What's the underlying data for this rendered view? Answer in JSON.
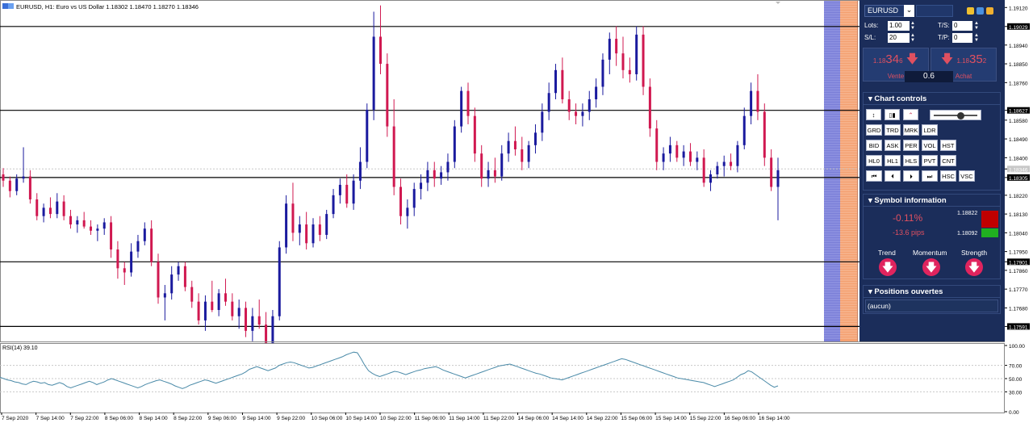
{
  "chart": {
    "header": "EURUSD, H1:  Euro vs US Dollar  1.18302 1.18470 1.18270 1.18346",
    "rsi_label": "RSI(14) 39.10",
    "price_axis": [
      "1.19120",
      "1.19029",
      "1.18940",
      "1.18850",
      "1.18760",
      "1.18627",
      "1.18580",
      "1.18490",
      "1.18400",
      "1.18346",
      "1.18305",
      "1.18220",
      "1.18130",
      "1.18040",
      "1.17950",
      "1.17901",
      "1.17860",
      "1.17770",
      "1.17680",
      "1.17591"
    ],
    "rsi_axis": [
      "100.00",
      "70.00",
      "50.00",
      "30.00",
      "0.00"
    ],
    "time_axis": [
      "7 Sep 2020",
      "7 Sep 14:00",
      "7 Sep 22:00",
      "8 Sep 06:00",
      "8 Sep 14:00",
      "8 Sep 22:00",
      "9 Sep 06:00",
      "9 Sep 14:00",
      "9 Sep 22:00",
      "10 Sep 06:00",
      "10 Sep 14:00",
      "10 Sep 22:00",
      "11 Sep 06:00",
      "11 Sep 14:00",
      "11 Sep 22:00",
      "14 Sep 06:00",
      "14 Sep 14:00",
      "14 Sep 22:00",
      "15 Sep 06:00",
      "15 Sep 14:00",
      "15 Sep 22:00",
      "16 Sep 06:00",
      "16 Sep 14:00"
    ],
    "level_lines": [
      1.19029,
      1.18627,
      1.18305,
      1.17901,
      1.17591
    ],
    "colors": {
      "bull": "#1a1a9e",
      "bear": "#d01850",
      "rsi": "#4a8aa8",
      "band_blue": "#7b7fd8",
      "band_orange": "#f4a070"
    },
    "candles": [
      [
        1.1832,
        1.1835,
        1.1826,
        1.1829
      ],
      [
        1.1829,
        1.1831,
        1.1821,
        1.1824
      ],
      [
        1.1824,
        1.1832,
        1.1822,
        1.183
      ],
      [
        1.183,
        1.1845,
        1.1828,
        1.1831
      ],
      [
        1.1831,
        1.1834,
        1.1818,
        1.182
      ],
      [
        1.182,
        1.1823,
        1.181,
        1.1812
      ],
      [
        1.1812,
        1.1818,
        1.1809,
        1.1816
      ],
      [
        1.1816,
        1.1821,
        1.1811,
        1.1813
      ],
      [
        1.1813,
        1.1823,
        1.1811,
        1.1819
      ],
      [
        1.1819,
        1.1822,
        1.181,
        1.1812
      ],
      [
        1.1812,
        1.1815,
        1.1806,
        1.1808
      ],
      [
        1.1808,
        1.1812,
        1.1804,
        1.181
      ],
      [
        1.181,
        1.1814,
        1.1806,
        1.1807
      ],
      [
        1.1807,
        1.181,
        1.1803,
        1.1805
      ],
      [
        1.1805,
        1.1808,
        1.18,
        1.1806
      ],
      [
        1.1806,
        1.1811,
        1.1803,
        1.1809
      ],
      [
        1.1809,
        1.1812,
        1.1792,
        1.1796
      ],
      [
        1.1796,
        1.18,
        1.1782,
        1.1787
      ],
      [
        1.1787,
        1.179,
        1.1779,
        1.1785
      ],
      [
        1.1785,
        1.1799,
        1.1783,
        1.1795
      ],
      [
        1.1795,
        1.1803,
        1.1792,
        1.18
      ],
      [
        1.18,
        1.1809,
        1.1798,
        1.1806
      ],
      [
        1.1806,
        1.181,
        1.1788,
        1.179
      ],
      [
        1.179,
        1.1794,
        1.177,
        1.1773
      ],
      [
        1.1773,
        1.1779,
        1.1762,
        1.1775
      ],
      [
        1.1775,
        1.1788,
        1.1772,
        1.1784
      ],
      [
        1.1784,
        1.179,
        1.1781,
        1.1788
      ],
      [
        1.1788,
        1.179,
        1.1776,
        1.1778
      ],
      [
        1.1778,
        1.1781,
        1.1768,
        1.1771
      ],
      [
        1.1771,
        1.1775,
        1.176,
        1.1762
      ],
      [
        1.1762,
        1.1774,
        1.1757,
        1.1771
      ],
      [
        1.1771,
        1.1781,
        1.1766,
        1.1767
      ],
      [
        1.1767,
        1.1777,
        1.1764,
        1.1775
      ],
      [
        1.1775,
        1.1782,
        1.1769,
        1.1771
      ],
      [
        1.1771,
        1.1775,
        1.1762,
        1.1764
      ],
      [
        1.1764,
        1.1772,
        1.1758,
        1.1768
      ],
      [
        1.1768,
        1.1771,
        1.1754,
        1.1757
      ],
      [
        1.1757,
        1.1768,
        1.1752,
        1.1764
      ],
      [
        1.1764,
        1.1772,
        1.1758,
        1.176
      ],
      [
        1.176,
        1.1766,
        1.1748,
        1.1751
      ],
      [
        1.1751,
        1.1767,
        1.1749,
        1.1764
      ],
      [
        1.1764,
        1.18,
        1.1762,
        1.1797
      ],
      [
        1.1797,
        1.1822,
        1.1794,
        1.1818
      ],
      [
        1.1818,
        1.1828,
        1.18,
        1.1804
      ],
      [
        1.1804,
        1.1812,
        1.1798,
        1.1808
      ],
      [
        1.1808,
        1.1814,
        1.1796,
        1.1799
      ],
      [
        1.1799,
        1.1811,
        1.1797,
        1.1808
      ],
      [
        1.1808,
        1.1812,
        1.18,
        1.1803
      ],
      [
        1.1803,
        1.1815,
        1.1801,
        1.1813
      ],
      [
        1.1813,
        1.1825,
        1.1811,
        1.1822
      ],
      [
        1.1822,
        1.183,
        1.1818,
        1.1827
      ],
      [
        1.1827,
        1.1832,
        1.1816,
        1.1818
      ],
      [
        1.1818,
        1.1832,
        1.1815,
        1.1829
      ],
      [
        1.1829,
        1.1845,
        1.1825,
        1.1838
      ],
      [
        1.1838,
        1.1866,
        1.1835,
        1.1863
      ],
      [
        1.1863,
        1.191,
        1.1858,
        1.1898
      ],
      [
        1.1898,
        1.1913,
        1.188,
        1.1885
      ],
      [
        1.1885,
        1.189,
        1.185,
        1.1855
      ],
      [
        1.1855,
        1.1868,
        1.1822,
        1.1826
      ],
      [
        1.1826,
        1.183,
        1.1808,
        1.1812
      ],
      [
        1.1812,
        1.182,
        1.1806,
        1.1816
      ],
      [
        1.1816,
        1.1828,
        1.1812,
        1.1825
      ],
      [
        1.1825,
        1.1832,
        1.182,
        1.1828
      ],
      [
        1.1828,
        1.1838,
        1.1824,
        1.1834
      ],
      [
        1.1834,
        1.1838,
        1.1826,
        1.183
      ],
      [
        1.183,
        1.1836,
        1.1827,
        1.1833
      ],
      [
        1.1833,
        1.1842,
        1.1829,
        1.1838
      ],
      [
        1.1838,
        1.1858,
        1.1835,
        1.1855
      ],
      [
        1.1855,
        1.1874,
        1.1852,
        1.1872
      ],
      [
        1.1872,
        1.1876,
        1.1856,
        1.186
      ],
      [
        1.186,
        1.1864,
        1.1838,
        1.1842
      ],
      [
        1.1842,
        1.1846,
        1.1826,
        1.183
      ],
      [
        1.183,
        1.1838,
        1.1826,
        1.1834
      ],
      [
        1.1834,
        1.184,
        1.1828,
        1.1831
      ],
      [
        1.1831,
        1.1846,
        1.1829,
        1.1842
      ],
      [
        1.1842,
        1.1852,
        1.1838,
        1.1848
      ],
      [
        1.1848,
        1.1855,
        1.1841,
        1.1844
      ],
      [
        1.1844,
        1.185,
        1.1834,
        1.1838
      ],
      [
        1.1838,
        1.1848,
        1.1835,
        1.1846
      ],
      [
        1.1846,
        1.1856,
        1.1842,
        1.1852
      ],
      [
        1.1852,
        1.1866,
        1.1848,
        1.1862
      ],
      [
        1.1862,
        1.1876,
        1.1858,
        1.1871
      ],
      [
        1.1871,
        1.1885,
        1.1868,
        1.1882
      ],
      [
        1.1882,
        1.1888,
        1.1866,
        1.1868
      ],
      [
        1.1868,
        1.1872,
        1.1858,
        1.1862
      ],
      [
        1.1862,
        1.1866,
        1.1856,
        1.186
      ],
      [
        1.186,
        1.1866,
        1.1855,
        1.1862
      ],
      [
        1.1862,
        1.1872,
        1.1858,
        1.1868
      ],
      [
        1.1868,
        1.1878,
        1.1864,
        1.1874
      ],
      [
        1.1874,
        1.189,
        1.187,
        1.1887
      ],
      [
        1.1887,
        1.19,
        1.188,
        1.1897
      ],
      [
        1.1897,
        1.1903,
        1.1884,
        1.189
      ],
      [
        1.189,
        1.1898,
        1.1878,
        1.1882
      ],
      [
        1.1882,
        1.1888,
        1.1876,
        1.188
      ],
      [
        1.188,
        1.1903,
        1.1877,
        1.1899
      ],
      [
        1.1899,
        1.1903,
        1.187,
        1.1874
      ],
      [
        1.1874,
        1.1878,
        1.185,
        1.1854
      ],
      [
        1.1854,
        1.1858,
        1.1834,
        1.1838
      ],
      [
        1.1838,
        1.1845,
        1.1834,
        1.1842
      ],
      [
        1.1842,
        1.185,
        1.1838,
        1.1846
      ],
      [
        1.1846,
        1.1848,
        1.1838,
        1.184
      ],
      [
        1.184,
        1.1846,
        1.1836,
        1.1843
      ],
      [
        1.1843,
        1.1847,
        1.1836,
        1.1838
      ],
      [
        1.1838,
        1.1843,
        1.1834,
        1.184
      ],
      [
        1.184,
        1.1844,
        1.1826,
        1.1828
      ],
      [
        1.1828,
        1.1834,
        1.1824,
        1.1832
      ],
      [
        1.1832,
        1.1838,
        1.183,
        1.1836
      ],
      [
        1.1836,
        1.1841,
        1.1831,
        1.1838
      ],
      [
        1.1838,
        1.1842,
        1.1834,
        1.1836
      ],
      [
        1.1836,
        1.1848,
        1.1833,
        1.1846
      ],
      [
        1.1846,
        1.1864,
        1.1844,
        1.186
      ],
      [
        1.186,
        1.1876,
        1.1856,
        1.1872
      ],
      [
        1.1872,
        1.188,
        1.1858,
        1.1862
      ],
      [
        1.1862,
        1.1866,
        1.1836,
        1.184
      ],
      [
        1.184,
        1.1844,
        1.1824,
        1.1826
      ],
      [
        1.1826,
        1.184,
        1.181,
        1.1834
      ]
    ],
    "rsi": [
      52,
      50,
      48,
      47,
      45,
      44,
      42,
      41,
      44,
      46,
      45,
      43,
      44,
      41,
      40,
      42,
      44,
      42,
      38,
      36,
      38,
      40,
      42,
      44,
      46,
      44,
      41,
      43,
      45,
      48,
      50,
      48,
      46,
      44,
      42,
      40,
      38,
      36,
      38,
      41,
      43,
      45,
      47,
      48,
      46,
      44,
      42,
      39,
      37,
      35,
      37,
      40,
      42,
      44,
      46,
      48,
      47,
      45,
      43,
      45,
      47,
      49,
      51,
      53,
      55,
      57,
      60,
      64,
      66,
      68,
      66,
      64,
      62,
      64,
      66,
      70,
      72,
      74,
      75,
      74,
      72,
      70,
      68,
      66,
      67,
      69,
      71,
      73,
      75,
      77,
      79,
      81,
      83,
      86,
      88,
      90,
      89,
      80,
      70,
      62,
      58,
      55,
      53,
      55,
      57,
      59,
      61,
      60,
      58,
      56,
      58,
      60,
      62,
      63,
      65,
      66,
      67,
      68,
      66,
      63,
      61,
      59,
      57,
      55,
      53,
      51,
      53,
      55,
      57,
      59,
      61,
      63,
      65,
      67,
      69,
      70,
      71,
      72,
      70,
      68,
      66,
      64,
      62,
      60,
      58,
      57,
      55,
      53,
      51,
      50,
      49,
      48,
      50,
      52,
      54,
      56,
      58,
      60,
      62,
      64,
      66,
      68,
      70,
      72,
      74,
      76,
      78,
      80,
      79,
      77,
      75,
      73,
      71,
      69,
      67,
      65,
      63,
      61,
      59,
      57,
      55,
      53,
      51,
      50,
      49,
      48,
      47,
      46,
      45,
      44,
      42,
      40,
      38,
      40,
      42,
      44,
      46,
      48,
      52,
      56,
      58,
      62,
      60,
      56,
      52,
      48,
      44,
      40,
      37,
      39
    ]
  },
  "panel": {
    "symbol": "EURUSD",
    "lots_label": "Lots:",
    "lots_value": "1.00",
    "sl_label": "S/L:",
    "sl_value": "20",
    "ts_label": "T/S:",
    "ts_value": "0",
    "tp_label": "T/P:",
    "tp_value": "0",
    "sell_price_prefix": "1.18",
    "sell_price_big": "34",
    "sell_price_sup": "6",
    "buy_price_prefix": "1.18",
    "buy_price_big": "35",
    "buy_price_sup": "2",
    "sell_label": "Vente",
    "buy_label": "Achat",
    "spread": "0.6",
    "chart_controls_title": "Chart controls",
    "row1": [
      "GRD",
      "TRD",
      "MRK",
      "LDR"
    ],
    "row2": [
      "BID",
      "ASK",
      "PER",
      "VOL",
      "HST"
    ],
    "row3": [
      "HL0",
      "HL1",
      "HLS",
      "PVT",
      "CNT"
    ],
    "row4": [
      "⏮",
      "⏴",
      "⏵",
      "⏭",
      "HSC",
      "VSC"
    ],
    "symbol_info_title": "Symbol information",
    "change_pct": "-0.11%",
    "change_pips": "-13.6 pips",
    "high_value": "1.18822",
    "low_value": "1.18092",
    "trend_label": "Trend",
    "momentum_label": "Momentum",
    "strength_label": "Strength",
    "positions_title": "Positions ouvertes",
    "positions_empty": "(aucun)"
  }
}
